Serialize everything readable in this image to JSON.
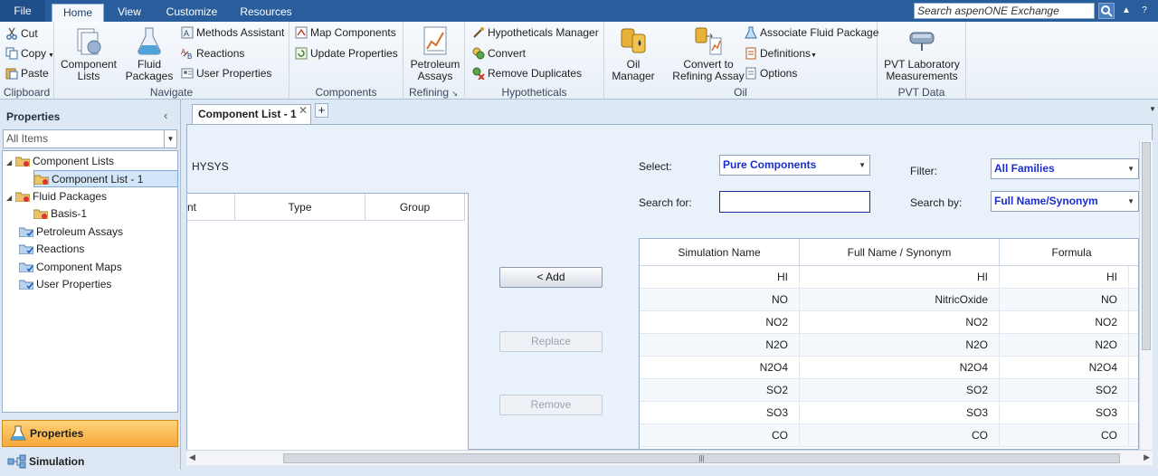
{
  "tabs": {
    "file": "File",
    "home": "Home",
    "view": "View",
    "customize": "Customize",
    "resources": "Resources"
  },
  "search": {
    "placeholder": "Search aspenONE Exchange"
  },
  "ribbon": {
    "clipboard": {
      "cut": "Cut",
      "copy": "Copy",
      "paste": "Paste",
      "label": "Clipboard"
    },
    "navigate": {
      "component_lists": [
        "Component",
        "Lists"
      ],
      "fluid_packages": [
        "Fluid",
        "Packages"
      ],
      "methods_assistant": "Methods Assistant",
      "reactions": "Reactions",
      "user_properties": "User Properties",
      "label": "Navigate"
    },
    "components": {
      "map_components": "Map Components",
      "update_properties": "Update Properties",
      "label": "Components"
    },
    "refining": {
      "petroleum_assays": [
        "Petroleum",
        "Assays"
      ],
      "label": "Refining"
    },
    "hypotheticals": {
      "manager": "Hypotheticals Manager",
      "convert": "Convert",
      "remove_duplicates": "Remove Duplicates",
      "label": "Hypotheticals"
    },
    "oil": {
      "oil_manager": [
        "Oil",
        "Manager"
      ],
      "convert_refining": [
        "Convert to",
        "Refining Assay"
      ],
      "associate_fluid": "Associate Fluid Package",
      "definitions": "Definitions",
      "options": "Options",
      "label": "Oil"
    },
    "pvt": {
      "pvt_lab": [
        "PVT Laboratory",
        "Measurements"
      ],
      "label": "PVT Data"
    }
  },
  "left_panel": {
    "title": "Properties",
    "filter": "All Items",
    "tree": {
      "component_lists": "Component Lists",
      "component_list_1": "Component List - 1",
      "fluid_packages": "Fluid Packages",
      "basis_1": "Basis-1",
      "petroleum_assays": "Petroleum Assays",
      "reactions": "Reactions",
      "component_maps": "Component Maps",
      "user_properties": "User Properties"
    },
    "nav_properties": "Properties",
    "nav_simulation": "Simulation"
  },
  "doc_tab": {
    "label": "Component List - 1"
  },
  "main": {
    "source": "HYSYS",
    "left_table_headers": [
      "nt",
      "Type",
      "Group"
    ],
    "add": "< Add",
    "replace": "Replace",
    "remove": "Remove",
    "select_label": "Select:",
    "select_value": "Pure Components",
    "search_for_label": "Search for:",
    "search_for_value": "",
    "filter_label": "Filter:",
    "filter_value": "All Families",
    "search_by_label": "Search by:",
    "search_by_value": "Full Name/Synonym",
    "right_table_headers": [
      "Simulation Name",
      "Full Name / Synonym",
      "Formula"
    ],
    "rows": [
      [
        "HI",
        "HI",
        "HI"
      ],
      [
        "NO",
        "NitricOxide",
        "NO"
      ],
      [
        "NO2",
        "NO2",
        "NO2"
      ],
      [
        "N2O",
        "N2O",
        "N2O"
      ],
      [
        "N2O4",
        "N2O4",
        "N2O4"
      ],
      [
        "SO2",
        "SO2",
        "SO2"
      ],
      [
        "SO3",
        "SO3",
        "SO3"
      ],
      [
        "CO",
        "CO",
        "CO"
      ]
    ]
  }
}
